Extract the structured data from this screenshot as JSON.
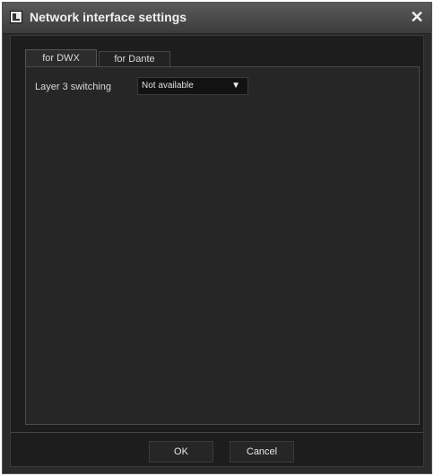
{
  "window": {
    "title": "Network interface settings",
    "icon": "app-icon",
    "close_icon": "close-icon",
    "close_glyph": "✕"
  },
  "tabs": [
    {
      "label": "for DWX",
      "selected": true
    },
    {
      "label": "for Dante",
      "selected": false
    }
  ],
  "settings": {
    "layer3_label": "Layer 3 switching",
    "layer3_value": "Not available",
    "dropdown_glyph": "▼"
  },
  "buttons": {
    "ok": "OK",
    "cancel": "Cancel"
  }
}
